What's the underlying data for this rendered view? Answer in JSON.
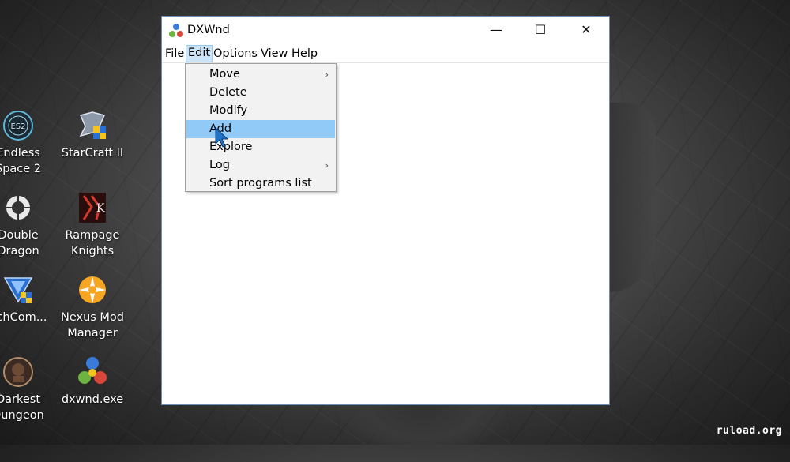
{
  "desktop": {
    "icons": [
      {
        "label_lines": [
          "Endless",
          "Space 2"
        ],
        "icon": "endless-space-icon"
      },
      {
        "label_lines": [
          "StarCraft II"
        ],
        "icon": "starcraft-icon"
      },
      {
        "label_lines": [
          "Double",
          "Dragon"
        ],
        "icon": "double-dragon-icon"
      },
      {
        "label_lines": [
          "Rampage",
          "Knights"
        ],
        "icon": "rampage-knights-icon"
      },
      {
        "label_lines": [
          "echCom..."
        ],
        "icon": "mechcom-icon"
      },
      {
        "label_lines": [
          "Nexus Mod",
          "Manager"
        ],
        "icon": "nexus-mod-icon"
      },
      {
        "label_lines": [
          "Darkest",
          "Dungeon"
        ],
        "icon": "darkest-dungeon-icon"
      },
      {
        "label_lines": [
          "dxwnd.exe"
        ],
        "icon": "dxwnd-exe-icon"
      }
    ],
    "watermark": "ruload.org"
  },
  "window": {
    "title": "DXWnd",
    "controls": {
      "minimize": "—",
      "maximize": "☐",
      "close": "✕"
    },
    "menu": [
      "File",
      "Edit",
      "Options",
      "View",
      "Help"
    ],
    "active_menu": "Edit"
  },
  "edit_menu": {
    "items": [
      {
        "label": "Move",
        "submenu": true
      },
      {
        "label": "Delete",
        "submenu": false
      },
      {
        "label": "Modify",
        "submenu": false
      },
      {
        "label": "Add",
        "submenu": false,
        "highlighted": true
      },
      {
        "label": "Explore",
        "submenu": false
      },
      {
        "label": "Log",
        "submenu": true
      },
      {
        "label": "Sort programs list",
        "submenu": false
      }
    ],
    "submenu_glyph": "›"
  },
  "colors": {
    "menu_highlight": "#91c9f7",
    "menu_active_bg": "#cce4f7",
    "cursor": "#1e73c8"
  }
}
